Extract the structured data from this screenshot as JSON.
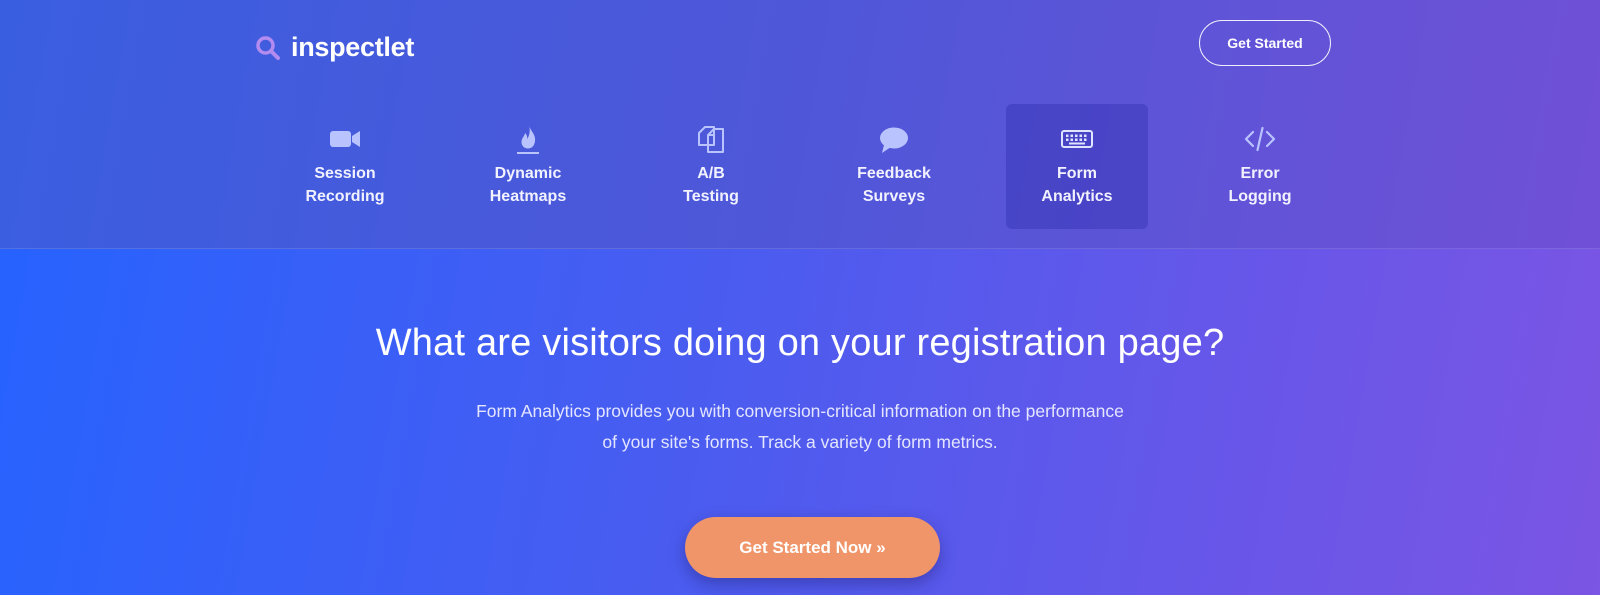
{
  "header": {
    "logo_text": "inspectlet",
    "cta_label": "Get Started"
  },
  "nav": {
    "items": [
      {
        "line1": "Session",
        "line2": "Recording",
        "icon": "video-camera-icon"
      },
      {
        "line1": "Dynamic",
        "line2": "Heatmaps",
        "icon": "flame-icon"
      },
      {
        "line1": "A/B",
        "line2": "Testing",
        "icon": "copy-pages-icon"
      },
      {
        "line1": "Feedback",
        "line2": "Surveys",
        "icon": "speech-bubble-icon"
      },
      {
        "line1": "Form",
        "line2": "Analytics",
        "icon": "keyboard-icon",
        "active": true
      },
      {
        "line1": "Error",
        "line2": "Logging",
        "icon": "code-icon"
      }
    ]
  },
  "hero": {
    "title": "What are visitors doing on your registration page?",
    "subtitle_line1": "Form Analytics provides you with conversion-critical information on the performance",
    "subtitle_line2": "of your site's forms. Track a variety of form metrics.",
    "cta_label": "Get Started Now »"
  },
  "colors": {
    "cta": "#f0956a",
    "logo_icon": "#b48cf0",
    "nav_icon": "#b9c4ff"
  }
}
